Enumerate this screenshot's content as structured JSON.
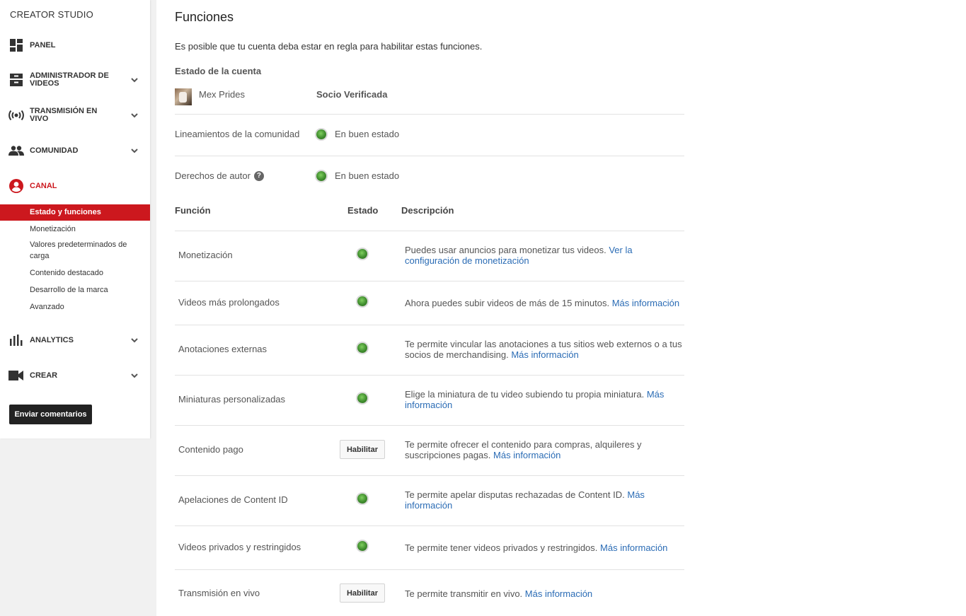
{
  "sidebar": {
    "brand": "CREATOR STUDIO",
    "items": [
      {
        "label": "PANEL",
        "icon": "dashboard-icon"
      },
      {
        "label": "ADMINISTRADOR DE VIDEOS",
        "icon": "video-manager-icon"
      },
      {
        "label": "TRANSMISIÓN EN VIVO",
        "icon": "live-broadcast-icon"
      },
      {
        "label": "COMUNIDAD",
        "icon": "community-icon"
      },
      {
        "label": "CANAL",
        "icon": "channel-icon"
      },
      {
        "label": "ANALYTICS",
        "icon": "analytics-icon"
      },
      {
        "label": "CREAR",
        "icon": "create-icon"
      }
    ],
    "channel_subitems": [
      "Estado y funciones",
      "Monetización",
      "Valores predeterminados de carga",
      "Contenido destacado",
      "Desarrollo de la marca",
      "Avanzado"
    ],
    "feedback_label": "Enviar comentarios",
    "active_color": "#cc181e"
  },
  "main": {
    "title": "Funciones",
    "intro": "Es posible que tu cuenta deba estar en regla para habilitar estas funciones.",
    "account_section_title": "Estado de la cuenta",
    "account": {
      "name": "Mex Prides",
      "status": "Socio Verificada"
    },
    "standing": [
      {
        "label": "Lineamientos de la comunidad",
        "status": "En buen estado",
        "help": false
      },
      {
        "label": "Derechos de autor",
        "status": "En buen estado",
        "help": true
      }
    ],
    "table_headers": {
      "feature": "Función",
      "state": "Estado",
      "description": "Descripción"
    },
    "features": [
      {
        "name": "Monetización",
        "state": "enabled",
        "desc": "Puedes usar anuncios para monetizar tus videos.",
        "link": "Ver la configuración de monetización"
      },
      {
        "name": "Videos más prolongados",
        "state": "enabled",
        "desc": "Ahora puedes subir videos de más de 15 minutos.",
        "link": "Más información"
      },
      {
        "name": "Anotaciones externas",
        "state": "enabled",
        "desc": "Te permite vincular las anotaciones a tus sitios web externos o a tus socios de merchandising.",
        "link": "Más información"
      },
      {
        "name": "Miniaturas personalizadas",
        "state": "enabled",
        "desc": "Elige la miniatura de tu video subiendo tu propia miniatura.",
        "link": "Más información"
      },
      {
        "name": "Contenido pago",
        "state": "button",
        "button_label": "Habilitar",
        "desc": "Te permite ofrecer el contenido para compras, alquileres y suscripciones pagas.",
        "link": "Más información"
      },
      {
        "name": "Apelaciones de Content ID",
        "state": "enabled",
        "desc": "Te permite apelar disputas rechazadas de Content ID.",
        "link": "Más información"
      },
      {
        "name": "Videos privados y restringidos",
        "state": "enabled",
        "desc": "Te permite tener videos privados y restringidos.",
        "link": "Más información"
      },
      {
        "name": "Transmisión en vivo",
        "state": "button",
        "button_label": "Habilitar",
        "desc": "Te permite transmitir en vivo.",
        "link": "Más información"
      }
    ],
    "link_color": "#2b6cb5",
    "status_dot_color": "#3f8c2e"
  }
}
